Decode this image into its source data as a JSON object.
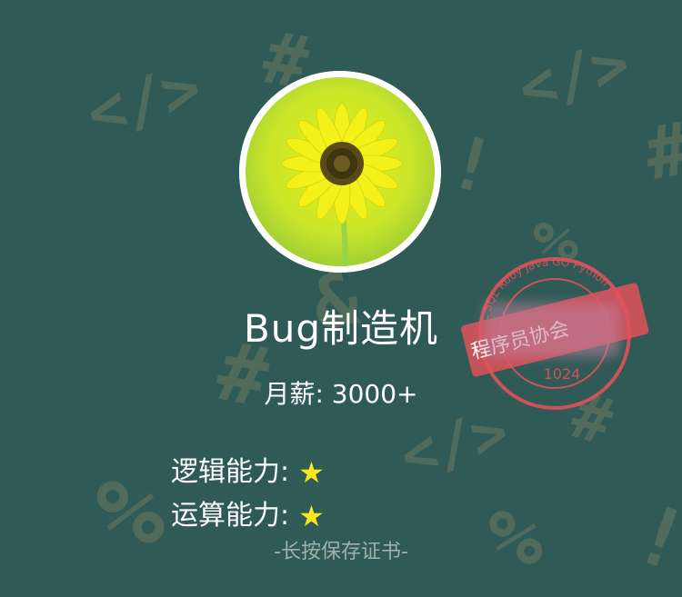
{
  "profile": {
    "name": "Bug制造机",
    "salary_label": "月薪: 3000+"
  },
  "abilities": [
    {
      "label": "逻辑能力:",
      "stars": 1
    },
    {
      "label": "运算能力:",
      "stars": 1
    }
  ],
  "star_glyph": "★",
  "hint": "-长按保存证书-",
  "stamp": {
    "title": "程序员协会",
    "number": "1024",
    "ring_text": "C SQL Ruby Java GO Python C++",
    "color": "#e0525a"
  },
  "background_symbols": [
    "</>",
    "#",
    "!",
    "%",
    "#",
    "</>",
    "&",
    "#",
    "%",
    "</>",
    "!",
    "%",
    "#"
  ],
  "colors": {
    "background": "#2f5a56",
    "text": "#ffffff",
    "star": "#f8e71c",
    "hint": "#9fb1a8"
  },
  "avatar": {
    "icon": "sunflower-image"
  }
}
